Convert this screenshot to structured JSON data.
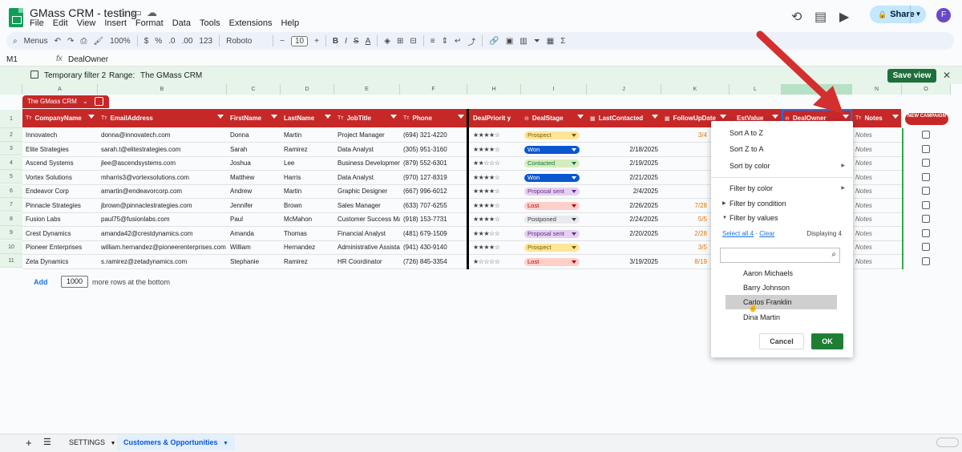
{
  "app": {
    "doc_title": "GMass CRM - testing",
    "menu": [
      "File",
      "Edit",
      "View",
      "Insert",
      "Format",
      "Data",
      "Tools",
      "Extensions",
      "Help"
    ],
    "share_label": "Share",
    "avatar_letter": "F"
  },
  "toolbar": {
    "menus_label": "Menus",
    "zoom": "100%",
    "currency": "$",
    "percent": "%",
    "dec_minus": ".0",
    "dec_plus": ".00",
    "num_format": "123",
    "font": "Roboto",
    "font_size": "10",
    "minus": "−",
    "plus": "+",
    "bold": "B",
    "italic": "I",
    "strike": "S",
    "text_color": "A"
  },
  "formula_bar": {
    "cell_ref": "M1",
    "fx": "fx",
    "content": "DealOwner"
  },
  "filter_bar": {
    "filter_name": "Temporary filter 2",
    "range_label": "Range:",
    "range_value": "The GMass CRM",
    "save_view": "Save view",
    "close": "✕"
  },
  "columns": [
    "A",
    "B",
    "C",
    "D",
    "E",
    "F",
    "H",
    "I",
    "J",
    "K",
    "L",
    "M",
    "N",
    "O"
  ],
  "row_numbers": [
    "1",
    "2",
    "3",
    "4",
    "5",
    "6",
    "7",
    "8",
    "9",
    "10",
    "11"
  ],
  "table": {
    "name": "The GMass CRM",
    "headers": {
      "company": "CompanyName",
      "email": "EmailAddress",
      "first": "FirstName",
      "last": "LastName",
      "job": "JobTitle",
      "phone": "Phone",
      "priority": "DealPriorit y",
      "stage": "DealStage",
      "contacted": "LastContacted",
      "followup": "FollowUpDate",
      "estvalue": "EstValue",
      "owner": "DealOwner",
      "notes": "Notes",
      "newcampaign": "NEW CAMPAIGN"
    },
    "rows": [
      {
        "company": "Innovatech",
        "email": "donna@innovatech.com",
        "first": "Donna",
        "last": "Martin",
        "job": "Project Manager",
        "phone": "(694) 321-4220",
        "stars": "★★★★☆",
        "stage": "Prospect",
        "contacted": "",
        "followup": "3/4",
        "notes": "Notes"
      },
      {
        "company": "Elite Strategies",
        "email": "sarah.t@elitestrategies.com",
        "first": "Sarah",
        "last": "Ramirez",
        "job": "Data Analyst",
        "phone": "(305) 951-3160",
        "stars": "★★★★☆",
        "stage": "Won",
        "contacted": "2/18/2025",
        "followup": "",
        "notes": "Notes"
      },
      {
        "company": "Ascend Systems",
        "email": "jlee@ascendsystems.com",
        "first": "Joshua",
        "last": "Lee",
        "job": "Business Developmen",
        "phone": "(879) 552-6301",
        "stars": "★★☆☆☆",
        "stage": "Contacted",
        "contacted": "2/19/2025",
        "followup": "",
        "notes": "Notes"
      },
      {
        "company": "Vortex Solutions",
        "email": "mharris3@vortexsolutions.com",
        "first": "Matthew",
        "last": "Harris",
        "job": "Data Analyst",
        "phone": "(970) 127-8319",
        "stars": "★★★★☆",
        "stage": "Won",
        "contacted": "2/21/2025",
        "followup": "",
        "notes": "Notes"
      },
      {
        "company": "Endeavor Corp",
        "email": "amartin@endeavorcorp.com",
        "first": "Andrew",
        "last": "Martin",
        "job": "Graphic Designer",
        "phone": "(667) 996-6012",
        "stars": "★★★★☆",
        "stage": "Proposal sent",
        "contacted": "2/4/2025",
        "followup": "",
        "notes": "Notes"
      },
      {
        "company": "Pinnacle Strategies",
        "email": "jbrown@pinnaclestrategies.com",
        "first": "Jennifer",
        "last": "Brown",
        "job": "Sales Manager",
        "phone": "(633) 707-6255",
        "stars": "★★★★☆",
        "stage": "Lost",
        "contacted": "2/26/2025",
        "followup": "7/28",
        "notes": "Notes"
      },
      {
        "company": "Fusion Labs",
        "email": "paul75@fusionlabs.com",
        "first": "Paul",
        "last": "McMahon",
        "job": "Customer Success Ma",
        "phone": "(918) 153-7731",
        "stars": "★★★★☆",
        "stage": "Postponed",
        "contacted": "2/24/2025",
        "followup": "5/5",
        "notes": "Notes"
      },
      {
        "company": "Crest Dynamics",
        "email": "amanda42@crestdynamics.com",
        "first": "Amanda",
        "last": "Thomas",
        "job": "Financial Analyst",
        "phone": "(481) 679-1509",
        "stars": "★★★☆☆",
        "stage": "Proposal sent",
        "contacted": "2/20/2025",
        "followup": "2/28",
        "notes": "Notes"
      },
      {
        "company": "Pioneer Enterprises",
        "email": "william.hernandez@pioneerenterprises.com",
        "first": "William",
        "last": "Hernandez",
        "job": "Administrative Assista",
        "phone": "(941) 430-9140",
        "stars": "★★★★☆",
        "stage": "Prospect",
        "contacted": "",
        "followup": "3/5",
        "notes": "Notes"
      },
      {
        "company": "Zeta Dynamics",
        "email": "s.ramirez@zetadynamics.com",
        "first": "Stephanie",
        "last": "Ramirez",
        "job": "HR Coordinator",
        "phone": "(726) 845-3354",
        "stars": "★☆☆☆☆",
        "stage": "Lost",
        "contacted": "3/19/2025",
        "followup": "8/19",
        "notes": "Notes"
      }
    ]
  },
  "stage_colors": {
    "Prospect": {
      "bg": "#ffe599",
      "fg": "#7a5b00"
    },
    "Won": {
      "bg": "#0b57d0",
      "fg": "#ffffff"
    },
    "Contacted": {
      "bg": "#d4edbc",
      "fg": "#11734b"
    },
    "Proposal sent": {
      "bg": "#e6cff2",
      "fg": "#5a3286"
    },
    "Lost": {
      "bg": "#ffcfc9",
      "fg": "#b10202"
    },
    "Postponed": {
      "bg": "#e8eaed",
      "fg": "#3c4043"
    }
  },
  "add_rows": {
    "add_label": "Add",
    "count": "1000",
    "suffix": "more rows at the bottom"
  },
  "filter_menu": {
    "sort_az": "Sort A to Z",
    "sort_za": "Sort Z to A",
    "sort_color": "Sort by color",
    "filter_color": "Filter by color",
    "filter_condition": "Filter by condition",
    "filter_values": "Filter by values",
    "select_all": "Select all 4",
    "dot": "·",
    "clear": "Clear",
    "displaying": "Displaying 4",
    "values": [
      "Aaron Michaels",
      "Barry Johnson",
      "Carlos Franklin",
      "Dina Martin"
    ],
    "highlighted_index": 2,
    "cancel": "Cancel",
    "ok": "OK"
  },
  "sheets": {
    "add": "+",
    "list": "☰",
    "tabs": [
      "SETTINGS",
      "Customers & Opportunities"
    ],
    "active_index": 1
  },
  "colors": {
    "header_red": "#c62828",
    "accent_green": "#1e7e34",
    "selection_blue": "#1a73e8",
    "arrow_red": "#d32f2f"
  }
}
